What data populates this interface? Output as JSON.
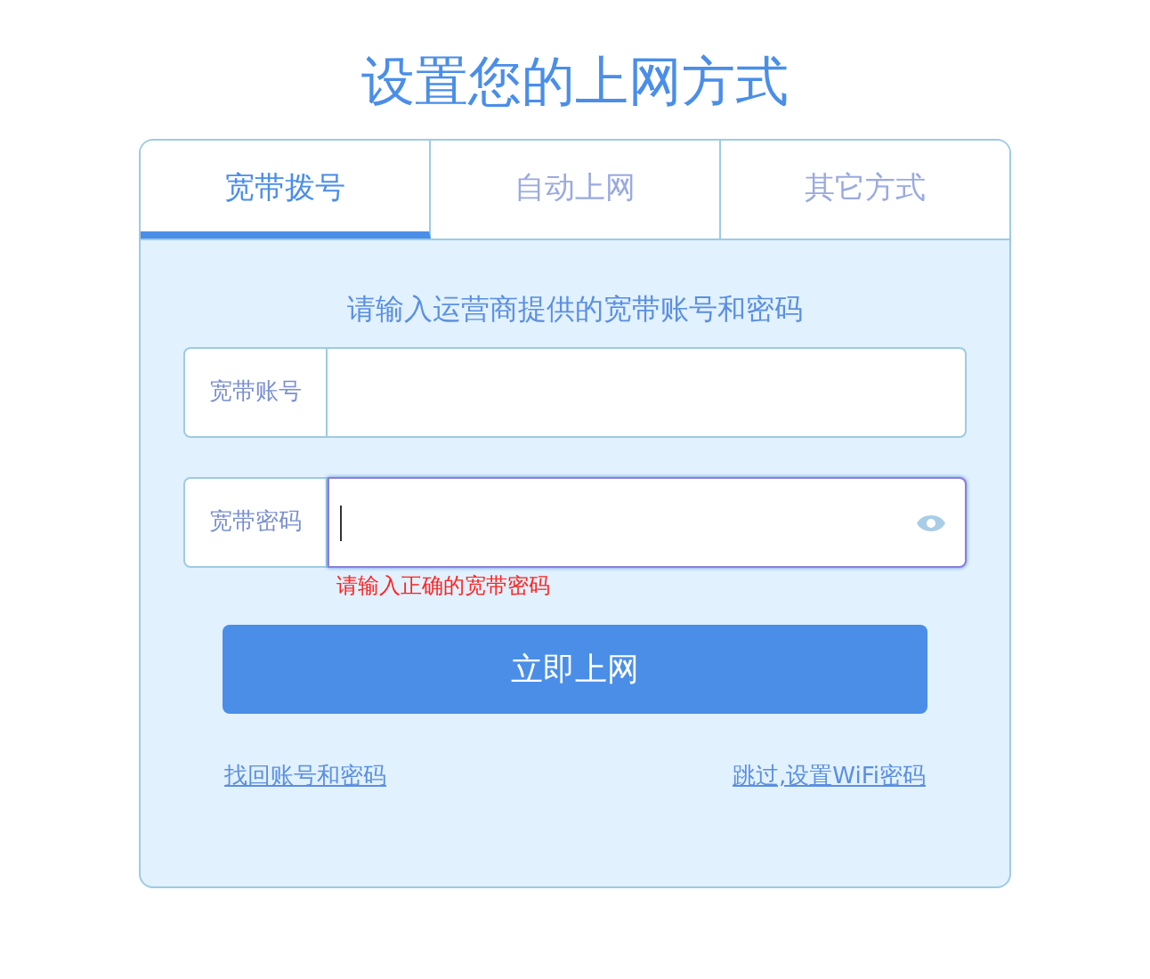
{
  "title": "设置您的上网方式",
  "tabs": [
    {
      "label": "宽带拨号",
      "selected": true
    },
    {
      "label": "自动上网",
      "selected": false
    },
    {
      "label": "其它方式",
      "selected": false
    }
  ],
  "prompt": "请输入运营商提供的宽带账号和密码",
  "fields": [
    {
      "kind": "text",
      "label": "宽带账号",
      "focused": false
    },
    {
      "kind": "password",
      "label": "宽带密码",
      "focused": true,
      "error": "请输入正确的宽带密码"
    }
  ],
  "submit_button": "立即上网",
  "links": [
    "找回账号和密码",
    "跳过,设置WiFi密码"
  ]
}
